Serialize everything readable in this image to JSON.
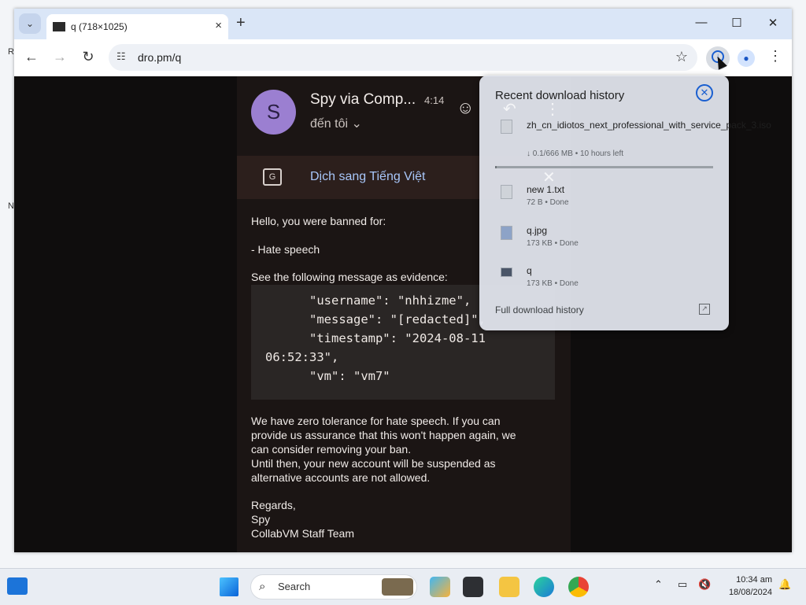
{
  "desktop": {
    "marks": [
      "R",
      "N"
    ]
  },
  "browser": {
    "tab": {
      "title": "q (718×1025)"
    },
    "address": "dro.pm/q"
  },
  "email": {
    "avatar_letter": "S",
    "sender": "Spy  via Comp...",
    "time": "4:14",
    "to": "đến tôi ⌄",
    "translate": "Dịch sang Tiếng Việt",
    "body": {
      "greeting": "Hello, you were banned for:",
      "reason": "- Hate speech",
      "evidence_intro": "See the following message as evidence:",
      "code_lines": [
        "      \"username\": \"nhhizme\",",
        "      \"message\": \"[redacted]\",",
        "      \"timestamp\": \"2024-08-11",
        "06:52:33\",",
        "      \"vm\": \"vm7\""
      ],
      "policy": [
        "We have zero tolerance for hate speech. If you can",
        "provide us assurance that this won't happen again, we",
        "can consider removing your ban.",
        "Until then, your new account will be suspended as",
        "alternative accounts are not allowed."
      ],
      "signoff": [
        "Regards,",
        "Spy",
        "CollabVM Staff Team"
      ]
    }
  },
  "downloads": {
    "title": "Recent download history",
    "items": [
      {
        "name": "zh_cn_idiotos_next_professional_with_service_pack_3.iso",
        "meta": "↓ 0.1/666 MB • 10 hours left",
        "icon": "file-icon",
        "progress": 0.0002
      },
      {
        "name": "new 1.txt",
        "meta": "72 B • Done",
        "icon": "file-icon"
      },
      {
        "name": "q.jpg",
        "meta": "173 KB • Done",
        "icon": "image-file-icon"
      },
      {
        "name": "q",
        "meta": "173 KB • Done",
        "icon": "folder-icon"
      }
    ],
    "full_history": "Full download history"
  },
  "taskbar": {
    "search": "Search",
    "time": "10:34 am",
    "date": "18/08/2024"
  }
}
